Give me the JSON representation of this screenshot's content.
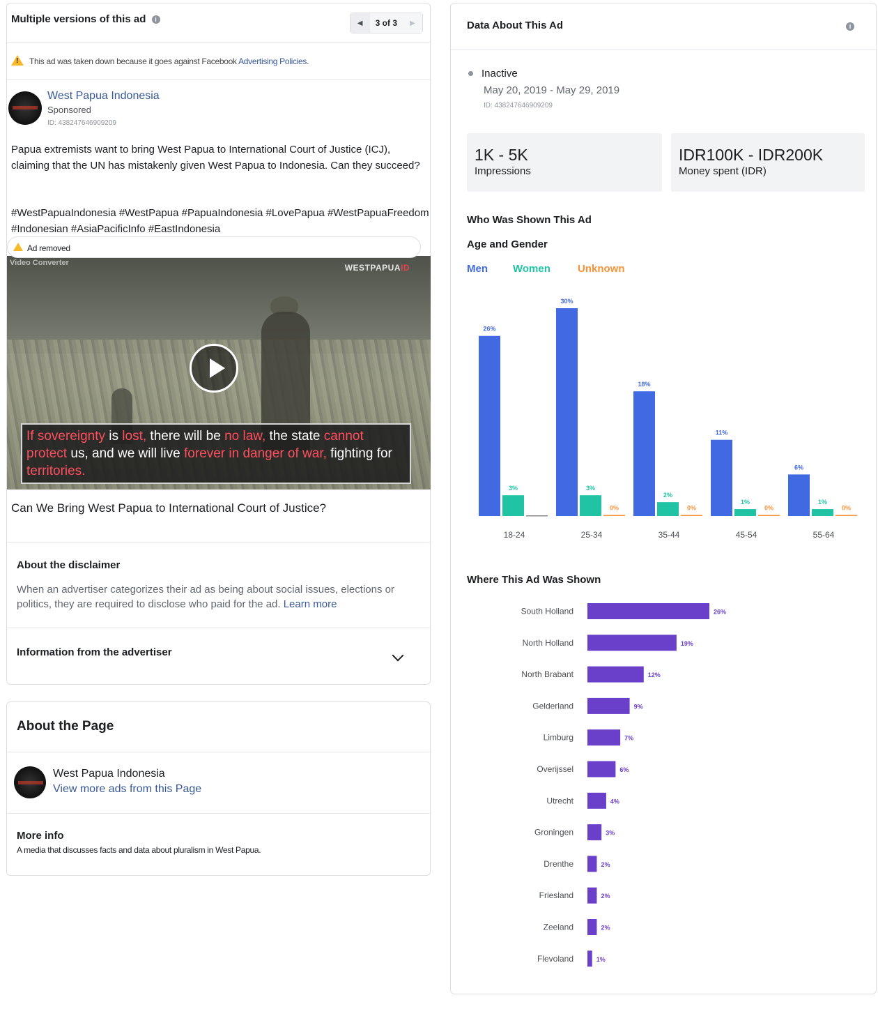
{
  "left": {
    "header": {
      "title": "Multiple versions of this ad",
      "pager_label": "3 of 3"
    },
    "warning": {
      "text": "This ad was taken down because it goes against Facebook ",
      "link": "Advertising Policies",
      "suffix": "."
    },
    "advertiser": {
      "name": "West Papua Indonesia",
      "sponsored": "Sponsored",
      "id": "ID: 438247646909209"
    },
    "ad_body": "Papua extremists want to bring West Papua to International Court of Justice (ICJ), claiming that the UN has mistakenly given West Papua to Indonesia. Can they succeed?",
    "ad_tags": "#WestPapuaIndonesia #WestPapua #PapuaIndonesia #LovePapua #WestPapuaFreedom #Indonesian #AsiaPacificInfo #EastIndonesia",
    "removed_label": "Ad removed",
    "video": {
      "brand_left": "Video Converter",
      "brand_right_a": "WESTPAPUA",
      "brand_right_b": "ID",
      "subtitle": {
        "s1": "If sovereignty",
        "s2": " is ",
        "s3": "lost,",
        "s4": " there will be ",
        "s5": "no law,",
        "s6": " the state ",
        "s7": "cannot protect",
        "s8": " us, and we will live ",
        "s9": "forever in danger of war,",
        "s10": " fighting for ",
        "s11": "territories."
      }
    },
    "caption": "Can We Bring West Papua to International Court of Justice?",
    "disclaimer": {
      "title": "About the disclaimer",
      "text": "When an advertiser categorizes their ad as being about social issues, elections or politics, they are required to disclose who paid for the ad. ",
      "link": "Learn more"
    },
    "info_title": "Information from the advertiser",
    "about": {
      "title": "About the Page",
      "name": "West Papua Indonesia",
      "link": "View more ads from this Page",
      "more_title": "More info",
      "more_text": "A media that discusses facts and data about pluralism in West Papua."
    }
  },
  "right": {
    "title": "Data About This Ad",
    "status": "Inactive",
    "dates": "May 20, 2019 - May 29, 2019",
    "id": "ID: 438247646909209",
    "impressions": {
      "value": "1K - 5K",
      "label": "Impressions"
    },
    "spend": {
      "value": "IDR100K - IDR200K",
      "label": "Money spent (IDR)"
    },
    "who_title": "Who Was Shown This Ad",
    "age_gender_title": "Age and Gender",
    "legend": {
      "men": "Men",
      "women": "Women",
      "unknown": "Unknown"
    },
    "where_title": "Where This Ad Was Shown"
  },
  "colors": {
    "men": "#4169e1",
    "women": "#20c3a4",
    "unknown": "#f7923a",
    "region": "#6a3fc9",
    "link": "#385898"
  },
  "chart_data": [
    {
      "type": "bar",
      "title": "Age and Gender",
      "categories": [
        "18-24",
        "25-34",
        "35-44",
        "45-54",
        "55-64"
      ],
      "series": [
        {
          "name": "Men",
          "values": [
            26,
            30,
            18,
            11,
            6
          ]
        },
        {
          "name": "Women",
          "values": [
            3,
            3,
            2,
            1,
            1
          ]
        },
        {
          "name": "Unknown",
          "values": [
            null,
            0,
            0,
            0,
            0
          ]
        }
      ],
      "ylim": [
        0,
        30
      ],
      "grid": false
    },
    {
      "type": "bar",
      "orientation": "horizontal",
      "title": "Where This Ad Was Shown",
      "categories": [
        "South Holland",
        "North Holland",
        "North Brabant",
        "Gelderland",
        "Limburg",
        "Overijssel",
        "Utrecht",
        "Groningen",
        "Drenthe",
        "Friesland",
        "Zeeland",
        "Flevoland"
      ],
      "values": [
        26,
        19,
        12,
        9,
        7,
        6,
        4,
        3,
        2,
        2,
        2,
        1
      ],
      "xlim": [
        0,
        26
      ],
      "grid": false
    }
  ]
}
